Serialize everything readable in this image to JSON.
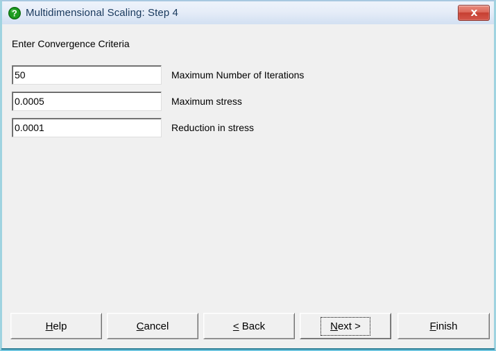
{
  "window": {
    "title": "Multidimensional Scaling: Step 4",
    "title_icon": "help-question-icon",
    "close_icon": "close-icon",
    "close_label": "Close",
    "accent_titlebar_color": "#e6edf8",
    "border_color": "#6ec4de",
    "client_background": "#f0f0f0",
    "help_icon_color": "#16941c",
    "close_button_color": "#c63f32"
  },
  "body": {
    "heading": "Enter Convergence Criteria",
    "fields": [
      {
        "name": "maximum-number-of-iterations",
        "value": "50",
        "placeholder": "",
        "label": "Maximum Number of Iterations"
      },
      {
        "name": "maximum-stress",
        "value": "0.0005",
        "placeholder": "",
        "label": "Maximum stress"
      },
      {
        "name": "reduction-in-stress",
        "value": "0.0001",
        "placeholder": "",
        "label": "Reduction in stress"
      }
    ]
  },
  "buttons": [
    {
      "name": "help-button",
      "label": "Help",
      "mnemonic_prefix": "",
      "mnemonic": "H",
      "mnemonic_suffix": "elp",
      "focused": false
    },
    {
      "name": "cancel-button",
      "label": "Cancel",
      "mnemonic_prefix": "",
      "mnemonic": "C",
      "mnemonic_suffix": "ancel",
      "focused": false
    },
    {
      "name": "back-button",
      "label": "< Back",
      "mnemonic_prefix": "",
      "mnemonic": "<",
      "mnemonic_suffix": " Back",
      "focused": false
    },
    {
      "name": "next-button",
      "label": "Next >",
      "mnemonic_prefix": "",
      "mnemonic": "N",
      "mnemonic_suffix": "ext >",
      "focused": true
    },
    {
      "name": "finish-button",
      "label": "Finish",
      "mnemonic_prefix": "",
      "mnemonic": "F",
      "mnemonic_suffix": "inish",
      "focused": false
    }
  ]
}
